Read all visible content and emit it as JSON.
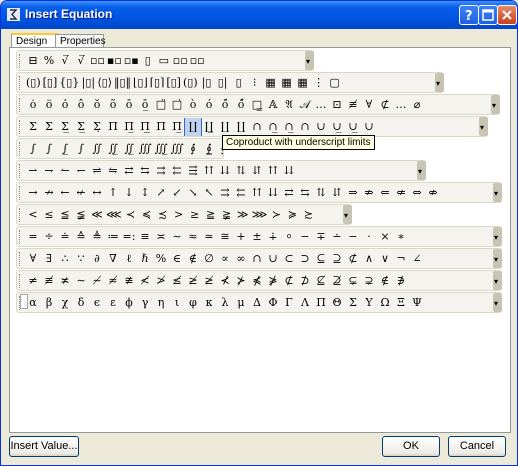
{
  "window": {
    "title": "Insert Equation"
  },
  "tabs": [
    {
      "label": "Design",
      "active": true
    },
    {
      "label": "Properties",
      "active": false
    }
  ],
  "toolbars": {
    "row1": [
      "⊟",
      "%",
      "√̅",
      "√̅",
      "▫▫",
      "▪▫",
      "▫▪",
      "▯",
      "▭",
      "▫▫",
      "▫▫"
    ],
    "row2": [
      "(▯)",
      "[▯]",
      "{▯}",
      "|▯|",
      "⟨▯⟩",
      "‖▯‖",
      "⌊▯⌋",
      "⌈▯⌉",
      "[▯]",
      "(▯)",
      "|▯",
      "▯|",
      "▯",
      "⁝",
      "▦",
      "▦",
      "▦",
      "⋮",
      "▢"
    ],
    "row3": [
      "ȯ",
      "ö",
      "ȯ̇",
      "ô",
      "ŏ",
      "õ",
      "ō",
      "ō̲",
      "□̈",
      "□̇",
      "ò",
      "ó",
      "ó̈",
      "ó̋",
      "□̳",
      "𝔸",
      "𝔄",
      "𝒜",
      "…",
      "⊡",
      "≢",
      "∀",
      "⊄",
      "…",
      "⌀"
    ],
    "row4": [
      "Σ",
      "Σ",
      "Σ̲",
      "Σ̲",
      "Σ̣",
      "Π",
      "Π̲",
      "Π̲̲",
      "Π",
      "Π̲",
      "∐",
      "∐̲",
      "∐",
      "∐",
      "∩",
      "∩̲",
      "∩̲",
      "∩",
      "∪",
      "∪̲",
      "∪̲",
      "∪"
    ],
    "row5": [
      "∫",
      "∫",
      "∫̲",
      "∫",
      "∬",
      "∬̲",
      "∬̲",
      "∭",
      "∭̲",
      "∭",
      "∮",
      "∮̲",
      "∯",
      "∯",
      "∰",
      "∱",
      "∲",
      "∳"
    ],
    "row6": [
      "⇀",
      "⇁",
      "↼",
      "↽",
      "⇌",
      "⇋",
      "⇄",
      "⇆",
      "⇉",
      "⇇",
      "⇶",
      "⇈",
      "⇊",
      "⇅",
      "⇵",
      "⇈",
      "⇊"
    ],
    "row7": [
      "→",
      "↛",
      "←",
      "↚",
      "↔",
      "↑",
      "↓",
      "↕",
      "↗",
      "↙",
      "↘",
      "↖",
      "⇉",
      "⇇",
      "⇈",
      "⇊",
      "⇄",
      "⇆",
      "⇅",
      "⇵",
      "⇒",
      "⇏",
      "⇐",
      "⇍",
      "⇔",
      "⇎"
    ],
    "row8": [
      "<",
      "≤",
      "≦",
      "≨",
      "≪",
      "⋘",
      "≺",
      "≼",
      "≾",
      ">",
      "≥",
      "≧",
      "≩",
      "≫",
      "⋙",
      "≻",
      "≽",
      "≿"
    ],
    "row9": [
      "=",
      "÷",
      "≐",
      "≙",
      "≜",
      "≔",
      "=:",
      "≡",
      "≍",
      "∼",
      "≈",
      "≃",
      "≅",
      "+",
      "±",
      "∔",
      "⸰",
      "−",
      "∓",
      "∸",
      "−",
      "·",
      "×",
      "∗"
    ],
    "row10": [
      "∀",
      "∃",
      "∴",
      "∵",
      "∂",
      "∇",
      "ℓ",
      "ℏ",
      "%",
      "∈",
      "∉",
      "∅",
      "∝",
      "∞",
      "∩",
      "∪",
      "⊂",
      "⊃",
      "⊆",
      "⊇",
      "⊄",
      "∧",
      "∨",
      "¬",
      "∠"
    ],
    "row11": [
      "≠",
      "≢",
      "≭",
      "∼",
      "≁",
      "≉",
      "≇",
      "≮",
      "≯",
      "≰",
      "≱",
      "≱",
      "⊀",
      "⊁",
      "⋠",
      "⋡",
      "⊄",
      "⊅",
      "⊈",
      "⊉",
      "⊊",
      "⊋",
      "∉",
      "∌"
    ],
    "row12": [
      "α",
      "β",
      "χ",
      "δ",
      "ϵ",
      "ε",
      "ϕ",
      "γ",
      "η",
      "ι",
      "φ",
      "κ",
      "λ",
      "μ",
      "Δ",
      "Φ",
      "Γ",
      "Λ",
      "Π",
      "Θ",
      "Σ",
      "Υ",
      "Ω",
      "Ξ",
      "Ψ"
    ]
  },
  "tooltip": "Coproduct with underscript limits",
  "buttons": {
    "insert_value": "Insert Value...",
    "ok": "OK",
    "cancel": "Cancel"
  },
  "colors": {
    "titlebar": "#0054e3",
    "dialog_bg": "#ece9d8",
    "highlight": "#c1d2ee"
  }
}
